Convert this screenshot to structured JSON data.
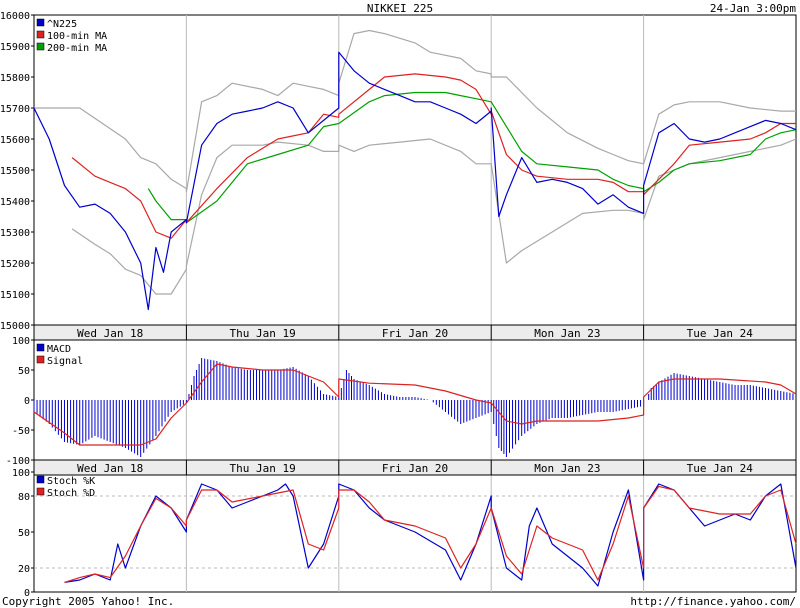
{
  "header": {
    "title": "NIKKEI 225",
    "timestamp": "24-Jan 3:00pm"
  },
  "footer": {
    "copyright": "Copyright 2005 Yahoo! Inc.",
    "url": "http://finance.yahoo.com/"
  },
  "colors": {
    "price": "#0000cc",
    "ma100": "#dd2222",
    "ma200": "#00a000",
    "band": "#a8a8a8",
    "macd": "#0000cc",
    "signal": "#dd2222",
    "stoch_k": "#0000cc",
    "stoch_d": "#dd2222",
    "grid": "#bbbbbb"
  },
  "chart_data": [
    {
      "type": "line",
      "panel": "price",
      "days": [
        "Wed Jan 18",
        "Thu Jan 19",
        "Fri Jan 20",
        "Mon Jan 23",
        "Tue Jan 24"
      ],
      "y_ticks": [
        16000,
        15900,
        15800,
        15700,
        15600,
        15500,
        15400,
        15300,
        15200,
        15100,
        15000
      ],
      "ylim": [
        15000,
        16000
      ],
      "grid": "day separators",
      "legend_position": "top-left",
      "series": [
        {
          "name": "^N225",
          "color_key": "price",
          "x": [
            0.0,
            0.1,
            0.2,
            0.3,
            0.4,
            0.5,
            0.6,
            0.7,
            0.75,
            0.8,
            0.85,
            0.9,
            0.95,
            1.0,
            1.0,
            1.1,
            1.2,
            1.3,
            1.4,
            1.5,
            1.6,
            1.7,
            1.8,
            1.9,
            2.0,
            2.0,
            2.1,
            2.2,
            2.3,
            2.4,
            2.5,
            2.6,
            2.7,
            2.8,
            2.9,
            3.0,
            3.0,
            3.05,
            3.1,
            3.2,
            3.3,
            3.4,
            3.5,
            3.6,
            3.7,
            3.8,
            3.9,
            4.0,
            4.0,
            4.1,
            4.2,
            4.3,
            4.4,
            4.5,
            4.6,
            4.7,
            4.8,
            4.9,
            5.0
          ],
          "y": [
            15700,
            15600,
            15450,
            15380,
            15390,
            15360,
            15300,
            15200,
            15050,
            15250,
            15170,
            15300,
            15320,
            15340,
            15330,
            15580,
            15650,
            15680,
            15690,
            15700,
            15720,
            15700,
            15620,
            15660,
            15700,
            15880,
            15820,
            15780,
            15760,
            15740,
            15720,
            15720,
            15700,
            15680,
            15650,
            15690,
            15700,
            15350,
            15420,
            15540,
            15460,
            15470,
            15460,
            15440,
            15390,
            15420,
            15380,
            15360,
            15450,
            15620,
            15650,
            15600,
            15590,
            15600,
            15620,
            15640,
            15660,
            15650,
            15630
          ]
        },
        {
          "name": "100-min MA",
          "color_key": "ma100",
          "x": [
            0.25,
            0.4,
            0.5,
            0.6,
            0.7,
            0.8,
            0.9,
            1.0,
            1.0,
            1.2,
            1.4,
            1.6,
            1.7,
            1.8,
            1.9,
            2.0,
            2.0,
            2.2,
            2.3,
            2.5,
            2.7,
            2.8,
            2.9,
            3.0,
            3.0,
            3.1,
            3.2,
            3.3,
            3.5,
            3.7,
            3.8,
            3.9,
            4.0,
            4.0,
            4.1,
            4.2,
            4.3,
            4.5,
            4.7,
            4.8,
            4.9,
            5.0
          ],
          "y": [
            15540,
            15480,
            15460,
            15440,
            15400,
            15300,
            15280,
            15340,
            15330,
            15440,
            15540,
            15600,
            15610,
            15620,
            15680,
            15670,
            15680,
            15760,
            15800,
            15810,
            15800,
            15790,
            15760,
            15680,
            15690,
            15550,
            15500,
            15480,
            15470,
            15470,
            15460,
            15430,
            15430,
            15420,
            15470,
            15520,
            15580,
            15590,
            15600,
            15620,
            15650,
            15650
          ]
        },
        {
          "name": "200-min MA",
          "color_key": "ma200",
          "x": [
            0.75,
            0.8,
            0.9,
            1.0,
            1.0,
            1.2,
            1.4,
            1.6,
            1.8,
            1.9,
            2.0,
            2.0,
            2.2,
            2.3,
            2.5,
            2.7,
            2.8,
            2.9,
            3.0,
            3.0,
            3.2,
            3.3,
            3.5,
            3.7,
            3.8,
            3.9,
            4.0,
            4.0,
            4.1,
            4.2,
            4.3,
            4.5,
            4.7,
            4.8,
            4.9,
            5.0
          ],
          "y": [
            15440,
            15400,
            15340,
            15340,
            15330,
            15400,
            15520,
            15550,
            15580,
            15640,
            15650,
            15650,
            15720,
            15740,
            15750,
            15750,
            15740,
            15730,
            15720,
            15720,
            15560,
            15520,
            15510,
            15500,
            15470,
            15450,
            15440,
            15430,
            15460,
            15500,
            15520,
            15530,
            15550,
            15600,
            15620,
            15630
          ]
        },
        {
          "name": "upper band",
          "color_key": "band",
          "x": [
            0.0,
            0.3,
            0.6,
            0.7,
            0.8,
            0.9,
            1.0,
            1.0,
            1.1,
            1.2,
            1.3,
            1.5,
            1.6,
            1.7,
            1.8,
            1.9,
            2.0,
            2.0,
            2.1,
            2.2,
            2.3,
            2.5,
            2.6,
            2.8,
            2.9,
            3.0,
            3.0,
            3.1,
            3.3,
            3.5,
            3.7,
            3.8,
            3.9,
            4.0,
            4.0,
            4.1,
            4.2,
            4.3,
            4.5,
            4.7,
            4.9,
            5.0
          ],
          "y": [
            15700,
            15700,
            15600,
            15540,
            15520,
            15470,
            15440,
            15430,
            15720,
            15740,
            15780,
            15760,
            15740,
            15780,
            15770,
            15760,
            15740,
            15780,
            15940,
            15950,
            15940,
            15910,
            15880,
            15860,
            15820,
            15810,
            15800,
            15800,
            15700,
            15620,
            15570,
            15550,
            15530,
            15520,
            15520,
            15680,
            15710,
            15720,
            15720,
            15700,
            15690,
            15690
          ]
        },
        {
          "name": "lower band",
          "color_key": "band",
          "x": [
            0.25,
            0.4,
            0.5,
            0.6,
            0.7,
            0.75,
            0.8,
            0.9,
            1.0,
            1.0,
            1.1,
            1.2,
            1.3,
            1.5,
            1.6,
            1.8,
            1.9,
            2.0,
            2.0,
            2.1,
            2.2,
            2.4,
            2.6,
            2.8,
            2.9,
            3.0,
            3.0,
            3.1,
            3.2,
            3.4,
            3.6,
            3.8,
            3.9,
            4.0,
            4.0,
            4.1,
            4.2,
            4.3,
            4.5,
            4.7,
            4.9,
            5.0
          ],
          "y": [
            15310,
            15260,
            15230,
            15180,
            15160,
            15130,
            15100,
            15100,
            15180,
            15190,
            15420,
            15540,
            15580,
            15580,
            15590,
            15580,
            15560,
            15560,
            15580,
            15560,
            15580,
            15590,
            15600,
            15560,
            15520,
            15520,
            15520,
            15200,
            15240,
            15300,
            15360,
            15370,
            15370,
            15360,
            15340,
            15480,
            15500,
            15520,
            15540,
            15560,
            15580,
            15600
          ]
        }
      ]
    },
    {
      "type": "bar",
      "panel": "macd",
      "days": [
        "Wed Jan 18",
        "Thu Jan 19",
        "Fri Jan 20",
        "Mon Jan 23",
        "Tue Jan 24"
      ],
      "y_ticks": [
        100,
        50,
        0,
        -50,
        -100
      ],
      "ylim": [
        -100,
        100
      ],
      "legend_position": "top-left",
      "series": [
        {
          "name": "MACD",
          "color_key": "macd",
          "style": "histogram",
          "x": [
            0.0,
            0.1,
            0.2,
            0.3,
            0.4,
            0.5,
            0.6,
            0.7,
            0.8,
            0.9,
            1.0,
            1.05,
            1.1,
            1.2,
            1.3,
            1.4,
            1.5,
            1.6,
            1.7,
            1.8,
            1.9,
            2.0,
            2.05,
            2.1,
            2.2,
            2.3,
            2.4,
            2.5,
            2.6,
            2.7,
            2.8,
            2.9,
            3.0,
            3.05,
            3.1,
            3.2,
            3.3,
            3.4,
            3.5,
            3.6,
            3.7,
            3.8,
            3.9,
            4.0,
            4.05,
            4.1,
            4.2,
            4.3,
            4.4,
            4.5,
            4.6,
            4.7,
            4.8,
            4.9,
            5.0
          ],
          "y": [
            -20,
            -40,
            -70,
            -75,
            -60,
            -70,
            -80,
            -95,
            -60,
            -20,
            -5,
            40,
            70,
            65,
            55,
            50,
            50,
            50,
            55,
            40,
            10,
            5,
            50,
            35,
            25,
            10,
            5,
            5,
            0,
            -20,
            -40,
            -30,
            -20,
            -80,
            -95,
            -60,
            -40,
            -30,
            -30,
            -25,
            -20,
            -20,
            -15,
            -10,
            20,
            30,
            45,
            40,
            35,
            30,
            25,
            25,
            20,
            15,
            10
          ]
        },
        {
          "name": "Signal",
          "color_key": "signal",
          "style": "line",
          "x": [
            0.0,
            0.2,
            0.3,
            0.5,
            0.7,
            0.8,
            0.9,
            1.0,
            1.0,
            1.1,
            1.2,
            1.3,
            1.5,
            1.7,
            1.9,
            2.0,
            2.0,
            2.2,
            2.5,
            2.7,
            2.9,
            3.0,
            3.0,
            3.1,
            3.2,
            3.3,
            3.5,
            3.7,
            3.9,
            4.0,
            4.0,
            4.1,
            4.2,
            4.5,
            4.8,
            4.9,
            5.0
          ],
          "y": [
            -20,
            -55,
            -75,
            -75,
            -75,
            -65,
            -30,
            -5,
            -5,
            30,
            60,
            55,
            50,
            50,
            30,
            5,
            35,
            28,
            25,
            15,
            0,
            -5,
            -5,
            -35,
            -40,
            -35,
            -35,
            -35,
            -30,
            -25,
            5,
            30,
            35,
            35,
            30,
            25,
            10
          ]
        }
      ]
    },
    {
      "type": "line",
      "panel": "stochastic",
      "days": [
        "Wed Jan 18",
        "Thu Jan 19",
        "Fri Jan 20",
        "Mon Jan 23",
        "Tue Jan 24"
      ],
      "y_ticks": [
        100,
        80,
        50,
        20,
        0
      ],
      "ylim": [
        0,
        100
      ],
      "grid": "dashed at 20 and 80",
      "legend_position": "top-left",
      "series": [
        {
          "name": "Stoch %K",
          "color_key": "stoch_k",
          "x": [
            0.2,
            0.3,
            0.4,
            0.5,
            0.55,
            0.6,
            0.7,
            0.8,
            0.9,
            1.0,
            1.0,
            1.1,
            1.2,
            1.3,
            1.4,
            1.5,
            1.6,
            1.65,
            1.7,
            1.8,
            1.9,
            2.0,
            2.0,
            2.1,
            2.2,
            2.3,
            2.5,
            2.7,
            2.8,
            2.9,
            3.0,
            3.0,
            3.1,
            3.2,
            3.25,
            3.3,
            3.4,
            3.5,
            3.6,
            3.7,
            3.8,
            3.9,
            4.0,
            4.0,
            4.1,
            4.2,
            4.3,
            4.4,
            4.5,
            4.6,
            4.7,
            4.8,
            4.9,
            5.0
          ],
          "y": [
            8,
            10,
            15,
            10,
            40,
            20,
            55,
            80,
            70,
            50,
            60,
            90,
            85,
            70,
            75,
            80,
            85,
            90,
            80,
            20,
            40,
            80,
            90,
            85,
            70,
            60,
            50,
            35,
            10,
            40,
            80,
            70,
            20,
            10,
            55,
            70,
            40,
            30,
            20,
            5,
            50,
            85,
            10,
            70,
            90,
            85,
            70,
            55,
            60,
            65,
            60,
            80,
            90,
            20
          ]
        },
        {
          "name": "Stoch %D",
          "color_key": "stoch_d",
          "x": [
            0.2,
            0.3,
            0.4,
            0.5,
            0.6,
            0.7,
            0.8,
            0.9,
            1.0,
            1.0,
            1.1,
            1.2,
            1.3,
            1.5,
            1.7,
            1.8,
            1.9,
            2.0,
            2.0,
            2.1,
            2.2,
            2.3,
            2.5,
            2.7,
            2.8,
            2.9,
            3.0,
            3.0,
            3.1,
            3.2,
            3.3,
            3.4,
            3.5,
            3.6,
            3.7,
            3.8,
            3.9,
            4.0,
            4.0,
            4.1,
            4.2,
            4.3,
            4.5,
            4.7,
            4.8,
            4.9,
            5.0
          ],
          "y": [
            8,
            12,
            15,
            12,
            30,
            55,
            78,
            70,
            55,
            60,
            85,
            85,
            75,
            80,
            85,
            40,
            35,
            70,
            85,
            85,
            75,
            60,
            55,
            45,
            20,
            40,
            70,
            70,
            30,
            15,
            55,
            45,
            40,
            35,
            10,
            40,
            80,
            20,
            70,
            88,
            85,
            70,
            65,
            65,
            80,
            85,
            40
          ]
        }
      ]
    }
  ]
}
